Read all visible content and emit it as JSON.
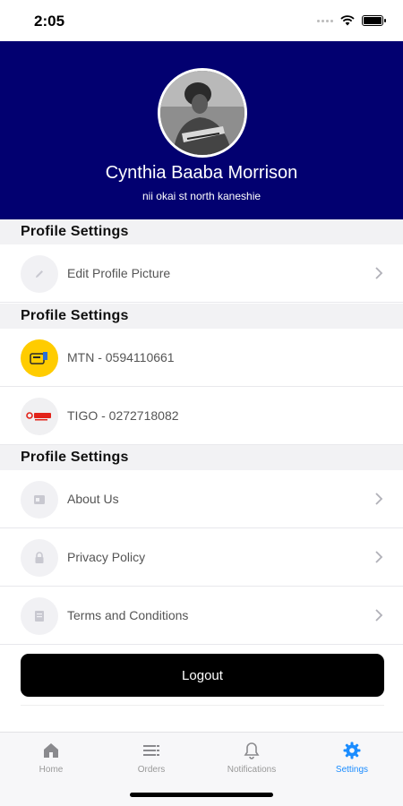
{
  "status": {
    "time": "2:05"
  },
  "profile": {
    "name": "Cynthia Baaba Morrison",
    "address": "nii okai st north kaneshie"
  },
  "sections": [
    {
      "title": "Profile Settings"
    },
    {
      "title": "Profile Settings"
    },
    {
      "title": "Profile Settings"
    }
  ],
  "rows": {
    "edit_picture": {
      "label": "Edit Profile Picture",
      "icon": "pencil-icon"
    },
    "mtn": {
      "label": "MTN - 0594110661",
      "icon": "mtn-logo"
    },
    "tigo": {
      "label": "TIGO - 0272718082",
      "icon": "airteltigo-logo"
    },
    "about": {
      "label": "About Us",
      "icon": "id-card-icon"
    },
    "privacy": {
      "label": "Privacy Policy",
      "icon": "lock-icon"
    },
    "terms": {
      "label": "Terms and Conditions",
      "icon": "document-icon"
    }
  },
  "logout": {
    "label": "Logout"
  },
  "tabs": [
    {
      "label": "Home",
      "icon": "home-icon",
      "active": false
    },
    {
      "label": "Orders",
      "icon": "list-icon",
      "active": false
    },
    {
      "label": "Notifications",
      "icon": "bell-icon",
      "active": false
    },
    {
      "label": "Settings",
      "icon": "gear-icon",
      "active": true
    }
  ],
  "colors": {
    "header_bg": "#020070",
    "accent": "#1a8cff",
    "mtn_yellow": "#ffcc00",
    "button_bg": "#000000"
  }
}
